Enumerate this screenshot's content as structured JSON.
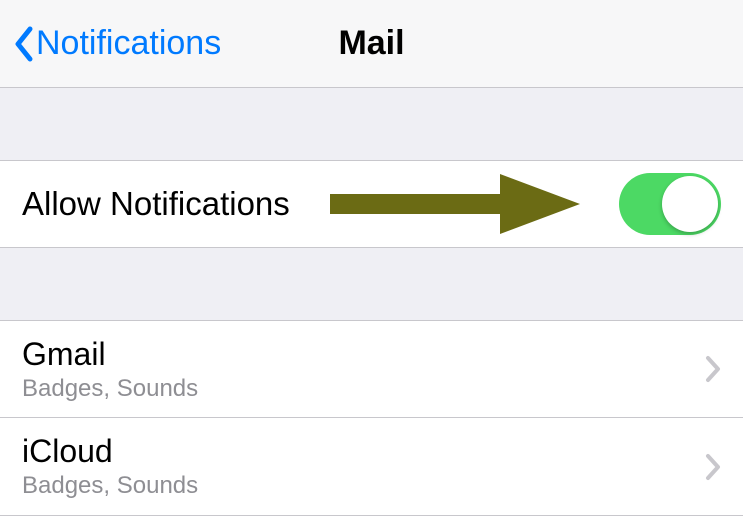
{
  "header": {
    "back_label": "Notifications",
    "title": "Mail"
  },
  "allow_row": {
    "label": "Allow Notifications",
    "toggle_on": true
  },
  "accounts": [
    {
      "title": "Gmail",
      "subtitle": "Badges, Sounds"
    },
    {
      "title": "iCloud",
      "subtitle": "Badges, Sounds"
    }
  ],
  "colors": {
    "accent": "#007aff",
    "toggle_on": "#4cd964",
    "separator": "#c8c7cc",
    "background": "#efeff4",
    "annotation_arrow": "#6b6b14"
  }
}
